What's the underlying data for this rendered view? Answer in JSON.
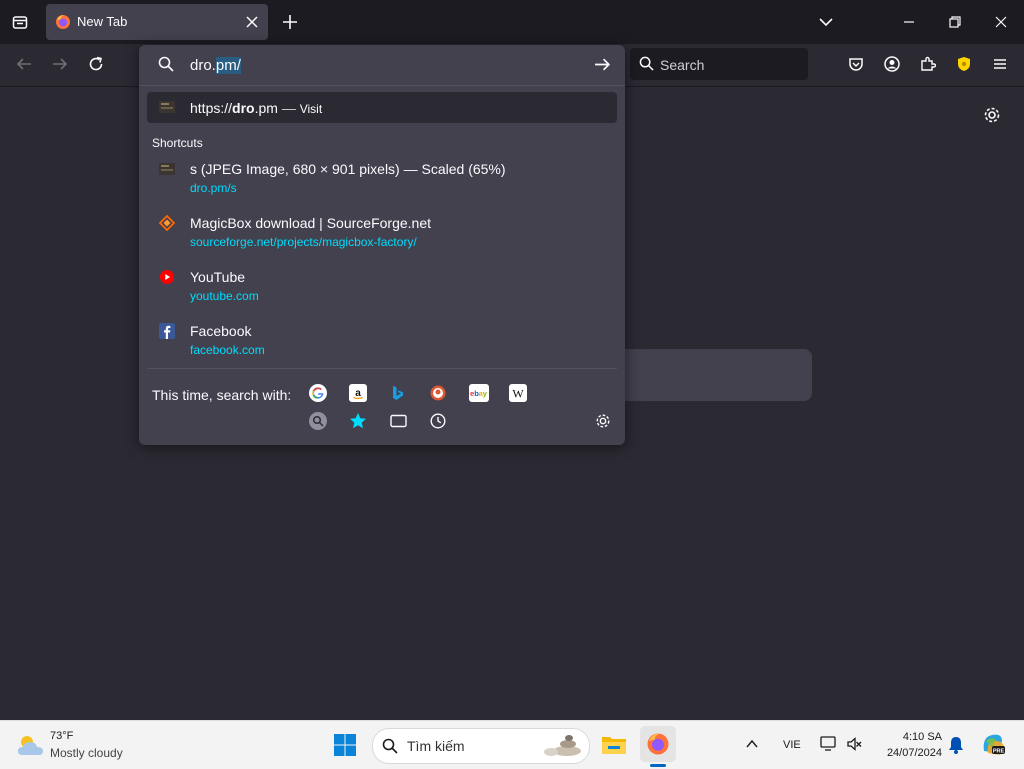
{
  "tab": {
    "title": "New Tab"
  },
  "nav": {
    "web_search_placeholder": "Search"
  },
  "urlbar": {
    "typed": "dro.",
    "autofill": "pm/"
  },
  "heuristic": {
    "prefix": "https://",
    "bold": "dro",
    "suffix": ".pm",
    "sep": " — ",
    "action": "Visit"
  },
  "shortcuts": {
    "header": "Shortcuts",
    "items": [
      {
        "title": "s (JPEG Image, 680 × 901 pixels) — Scaled (65%)",
        "url": "dro.pm/s",
        "icon": "image-icon"
      },
      {
        "title": "MagicBox download | SourceForge.net",
        "url": "sourceforge.net/projects/magicbox-factory/",
        "icon": "sourceforge-icon"
      },
      {
        "title": "YouTube",
        "url": "youtube.com",
        "icon": "youtube-icon"
      },
      {
        "title": "Facebook",
        "url": "facebook.com",
        "icon": "facebook-icon"
      }
    ]
  },
  "search_with": {
    "label": "This time, search with:",
    "engines": [
      "google-icon",
      "amazon-icon",
      "bing-icon",
      "duckduckgo-icon",
      "ebay-icon",
      "wikipedia-icon"
    ],
    "modes": [
      "search-mode-icon",
      "bookmarks-star-icon",
      "tabs-icon",
      "history-clock-icon"
    ]
  },
  "taskbar": {
    "weather_temp": "73°F",
    "weather_desc": "Mostly cloudy",
    "search_placeholder": "Tìm kiếm",
    "lang": "VIE",
    "time": "4:10 SA",
    "date": "24/07/2024"
  },
  "colors": {
    "accent_url": "#00ddff",
    "popup_bg": "#42414d",
    "page_bg": "#2b2a33",
    "tabstrip_bg": "#1c1b22"
  }
}
